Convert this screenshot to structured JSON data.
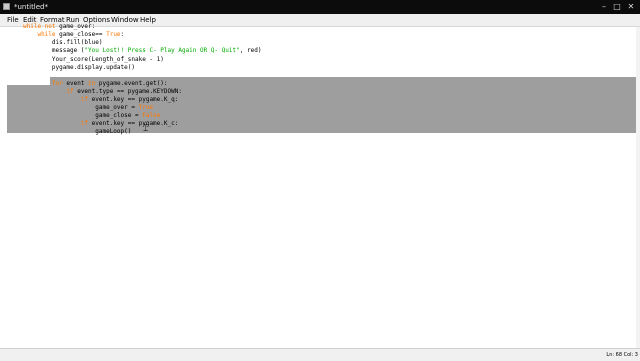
{
  "window": {
    "title": "*untitled*"
  },
  "menu": [
    "File",
    "Edit",
    "Format",
    "Run",
    "Options",
    "Window",
    "Help"
  ],
  "code": [
    "while not game_over:",
    "    while game_close== True:",
    "        dis.fill(blue)",
    "        message (\"You Lost!! Press C- Play Again OR Q- Quit\", red)",
    "        Your_score(Length_of_snake - 1)",
    "        pygame.display.update()",
    "",
    "        for event in pygame.event.get():",
    "            if event.type == pygame.KEYDOWN:",
    "                if event.key == pygame.K_q:",
    "                    game_over = True",
    "                    game_close = False",
    "                if event.key == pygame.K_c:",
    "                    gameLoop()"
  ],
  "status": {
    "line": "Ln: 68",
    "col": "Col: 3"
  },
  "colors": {
    "keyword": "#ff7700",
    "string": "#00aa00",
    "selection": "#9e9e9e"
  }
}
